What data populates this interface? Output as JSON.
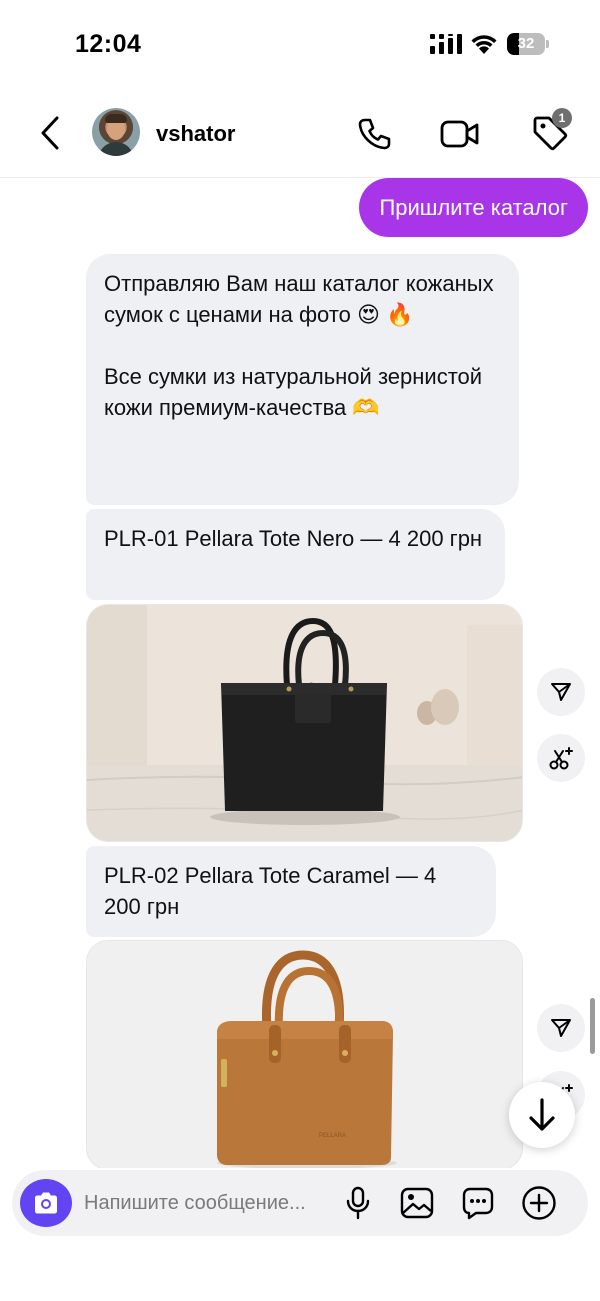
{
  "status_bar": {
    "time": "12:04",
    "battery_level": "32"
  },
  "header": {
    "username": "vshator",
    "tag_badge_count": "1"
  },
  "messages": {
    "sent_1": "Пришлите каталог",
    "received_1_line_1": "Отправляю Вам наш каталог кожаных сумок с ценами на фото 😍 🔥",
    "received_1_line_2": "Все сумки из натуральной зернистой кожи премиум-качества 🫶",
    "received_2": "PLR-01 Pellara Tote Nero — 4 200 грн",
    "received_3": "PLR-02 Pellara Tote Caramel — 4 200 грн"
  },
  "composer": {
    "placeholder": "Напишите сообщение..."
  },
  "colors": {
    "sent_bubble": "#a935e8",
    "received_bubble": "#eef0f4",
    "camera_button": "#6244f2"
  },
  "icons": {
    "back": "chevron-left-icon",
    "call": "phone-icon",
    "video": "video-camera-icon",
    "tag": "tag-icon",
    "share": "send-icon",
    "remix": "scissors-sparkle-icon",
    "scroll_down": "arrow-down-icon",
    "camera": "camera-icon",
    "mic": "microphone-icon",
    "gallery": "image-icon",
    "sticker": "chat-bubble-icon",
    "plus": "plus-circle-icon"
  }
}
